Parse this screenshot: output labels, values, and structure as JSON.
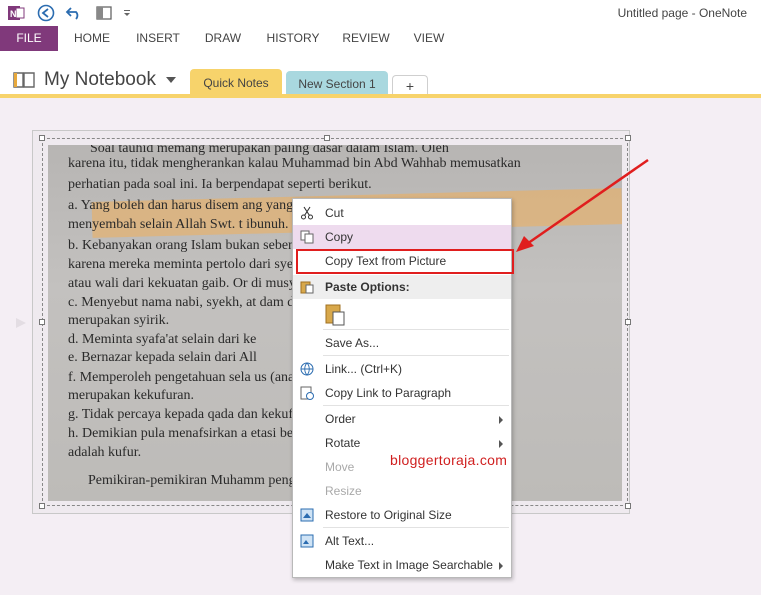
{
  "app": {
    "title": "Untitled page - OneNote"
  },
  "ribbon": {
    "tabs": [
      "FILE",
      "HOME",
      "INSERT",
      "DRAW",
      "HISTORY",
      "REVIEW",
      "VIEW"
    ]
  },
  "notebook": {
    "name": "My Notebook",
    "sections": [
      "Quick Notes",
      "New Section 1"
    ],
    "add_tab": "+"
  },
  "photo_text": [
    "Soal tauhid memang merupakan paling dasar dalam Islam. Oleh",
    "karena itu, tidak mengherankan kalau Muhammad bin Abd Wahhab memusatkan",
    "perhatian pada soal ini. Ia berpendapat seperti berikut.",
    "a.  Yang boleh dan harus disem                              ang yang",
    "     menyembah selain Allah Swt. t                        ibunuh.",
    "b.  Kebanyakan orang Islam bukan                         sebenarnya",
    "     karena mereka meminta pertolo                        dari syekh",
    "     atau wali dari kekuatan gaib. Or                       di musyrik.",
    "c.  Menyebut nama nabi, syekh, at                       dam doa juga",
    "     merupakan syirik.",
    "d.  Meminta syafa'at selain dari ke",
    "e.  Bernazar kepada selain dari All",
    "f.   Memperoleh pengetahuan sela                       us (analogi)",
    "     merupakan kekufuran.",
    "g.  Tidak percaya kepada qada dan                       kekufuran.",
    "h.  Demikian pula menafsirkan a                         etasi bebas)",
    "     adalah kufur.",
    "Pemikiran-pemikiran Muhamm                              pengaruh"
  ],
  "context_menu": {
    "items": [
      {
        "label": "Cut",
        "icon": "scissors-icon"
      },
      {
        "label": "Copy",
        "icon": "copy-icon"
      },
      {
        "label": "Copy Text from Picture"
      },
      {
        "label": "Paste Options:",
        "icon": "paste-icon"
      },
      {
        "label": "Save As..."
      },
      {
        "label": "Link...  (Ctrl+K)",
        "icon": "link-icon"
      },
      {
        "label": "Copy Link to Paragraph",
        "icon": "link-paragraph-icon"
      },
      {
        "label": "Order",
        "submenu": true
      },
      {
        "label": "Rotate",
        "submenu": true
      },
      {
        "label": "Move",
        "disabled": true
      },
      {
        "label": "Resize",
        "disabled": true
      },
      {
        "label": "Restore to Original Size",
        "icon": "restore-size-icon"
      },
      {
        "label": "Alt Text...",
        "icon": "alt-text-icon"
      },
      {
        "label": "Make Text in Image Searchable",
        "submenu": true
      }
    ]
  },
  "watermark": "bloggertoraja.com",
  "colors": {
    "file_tab": "#80397b",
    "quick_notes": "#f7d36b",
    "new_section": "#a9d8df",
    "annotation": "#e01e1e"
  }
}
